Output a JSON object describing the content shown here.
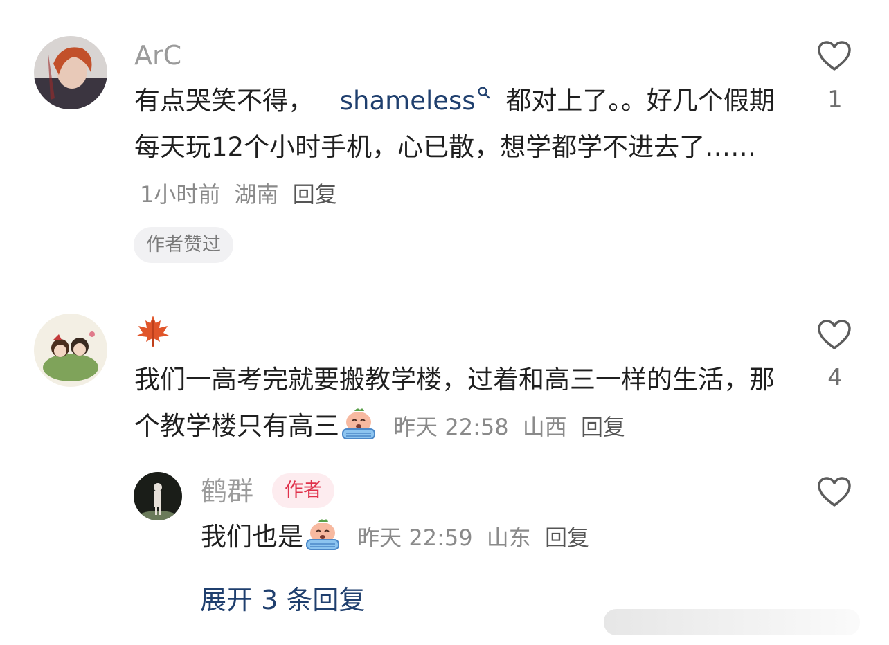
{
  "comments": [
    {
      "username": "ArC",
      "text_before": "有点哭笑不得，",
      "link": "shameless",
      "text_after": "都对上了。。好几个假期每天玩12个小时手机，心已散，想学都学不进去了……",
      "time": "1小时前",
      "location": "湖南",
      "reply_label": "回复",
      "badge": "作者赞过",
      "likes": "1"
    },
    {
      "username_emoji": "maple-leaf",
      "text": "我们一高考完就要搬教学楼，过着和高三一样的生活，那个教学楼只有高三",
      "time": "昨天 22:58",
      "location": "山西",
      "reply_label": "回复",
      "likes": "4",
      "reply": {
        "username": "鹤群",
        "author_tag": "作者",
        "text": "我们也是",
        "time": "昨天 22:59",
        "location": "山东",
        "reply_label": "回复"
      }
    }
  ],
  "expand_label": "展开 3 条回复",
  "colors": {
    "link": "#1f3f6e",
    "author_tag_bg": "#fdecef",
    "author_tag_text": "#e0314b",
    "badge_bg": "#f1f1f3"
  }
}
